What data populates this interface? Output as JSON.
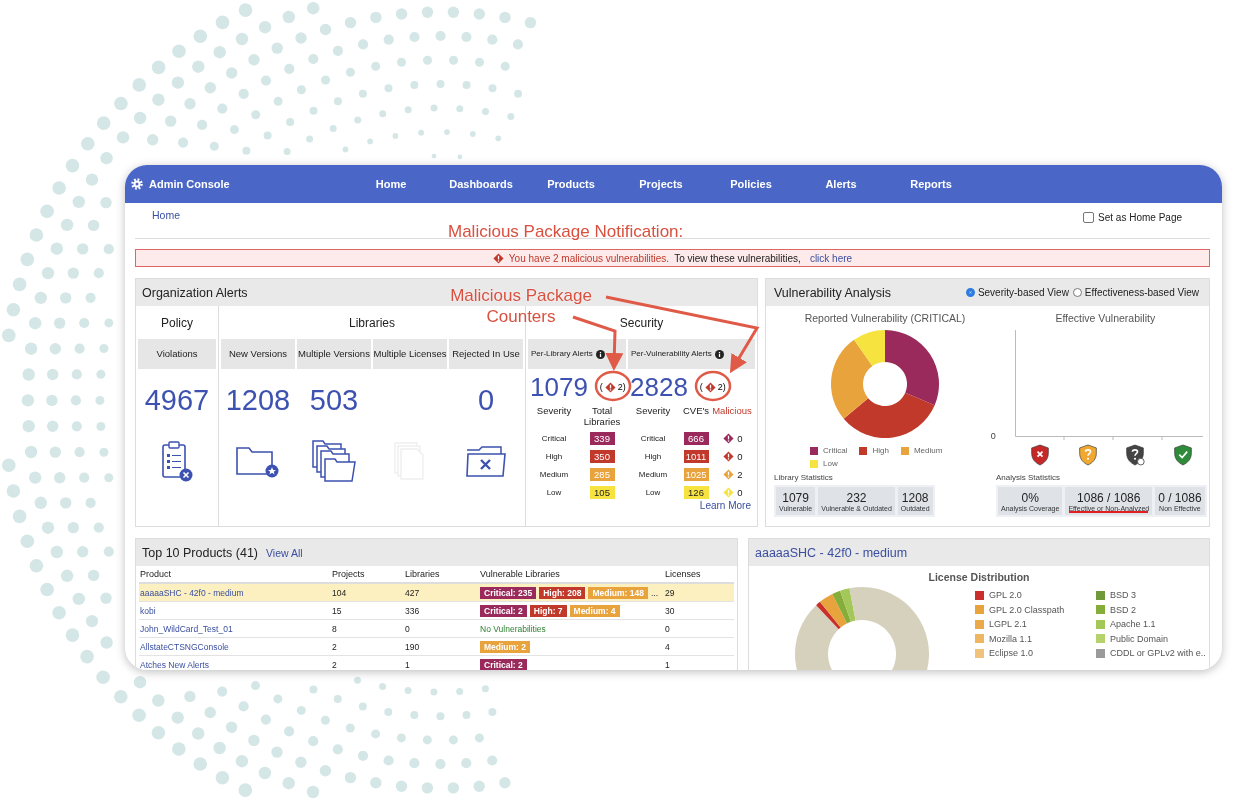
{
  "nav": {
    "title": "Admin Console",
    "items": [
      "Home",
      "Dashboards",
      "Products",
      "Projects",
      "Policies",
      "Alerts",
      "Reports"
    ]
  },
  "breadcrumb": "Home",
  "home_page_checkbox": {
    "label": "Set as Home Page",
    "checked": false
  },
  "annotations": [
    {
      "text": "Malicious Package Notification:"
    },
    {
      "text": "Malicious Package Counters"
    }
  ],
  "alert_banner": {
    "message": "You have 2 malicious vulnerabilities.",
    "hint": "To view these vulnerabilities,",
    "link": "click here"
  },
  "org_alerts": {
    "title": "Organization Alerts",
    "policy": {
      "label": "Policy",
      "columns": [
        {
          "header": "Violations",
          "value": "4967",
          "kind": "violations"
        }
      ]
    },
    "libraries": {
      "label": "Libraries",
      "columns": [
        {
          "header": "New Versions",
          "value": "1208",
          "kind": "new",
          "disabled": false
        },
        {
          "header": "Multiple Versions",
          "value": "503",
          "kind": "versions",
          "disabled": false
        },
        {
          "header": "Multiple Licenses",
          "kind": "licenses",
          "disabled": true
        },
        {
          "header": "Rejected In Use",
          "value": "0",
          "kind": "rejected",
          "disabled": false
        }
      ]
    },
    "security": {
      "label": "Security",
      "per_library": {
        "header": "Per-Library Alerts",
        "value": "1079",
        "malicious_open": "(",
        "malicious_count": "2)",
        "severity_header": "Severity",
        "count_header": "Total Libraries",
        "rows": [
          {
            "label": "Critical",
            "count": "339",
            "color": "#9b2a5c"
          },
          {
            "label": "High",
            "count": "350",
            "color": "#c0392b"
          },
          {
            "label": "Medium",
            "count": "285",
            "color": "#e8a33d"
          },
          {
            "label": "Low",
            "count": "105",
            "color": "#f6e33f"
          }
        ]
      },
      "per_vulnerability": {
        "header": "Per-Vulnerability Alerts",
        "value": "2828",
        "malicious_open": "(",
        "malicious_count": "2)",
        "severity_header": "Severity",
        "count_header": "CVE's",
        "malicious_header": "Malicious",
        "rows": [
          {
            "label": "Critical",
            "count": "666",
            "malicious": "0",
            "color": "#9b2a5c"
          },
          {
            "label": "High",
            "count": "1011",
            "malicious": "0",
            "color": "#c0392b"
          },
          {
            "label": "Medium",
            "count": "1025",
            "malicious": "2",
            "color": "#e8a33d"
          },
          {
            "label": "Low",
            "count": "126",
            "malicious": "0",
            "color": "#f6e33f"
          }
        ]
      },
      "learn_more": "Learn More"
    }
  },
  "vulnerability_analysis": {
    "title": "Vulnerability Analysis",
    "views": [
      {
        "label": "Severity-based View",
        "selected": true
      },
      {
        "label": "Effectiveness-based View",
        "selected": false
      }
    ],
    "reported": {
      "title": "Reported Vulnerability (CRITICAL)",
      "legend": [
        {
          "label": "Critical",
          "color": "#9b2a5c"
        },
        {
          "label": "High",
          "color": "#c0392b"
        },
        {
          "label": "Medium",
          "color": "#e8a33d"
        },
        {
          "label": "Low",
          "color": "#f6e33f"
        }
      ]
    },
    "effective": {
      "title": "Effective Vulnerability",
      "y_tick": "0"
    },
    "library_statistics": {
      "title": "Library Statistics",
      "items": [
        {
          "value": "1079",
          "label": "Vulnerable"
        },
        {
          "value": "232",
          "label": "Vulnerable & Outdated"
        },
        {
          "value": "1208",
          "label": "Outdated"
        }
      ]
    },
    "analysis_statistics": {
      "title": "Analysis Statistics",
      "items": [
        {
          "value": "0%",
          "label": "Analysis Coverage",
          "highlighted": false
        },
        {
          "value": "1086 / 1086",
          "label": "Effective or Non-Analyzed",
          "highlighted": true
        },
        {
          "value": "0 / 1086",
          "label": "Non Effective",
          "highlighted": false
        }
      ]
    }
  },
  "top_products": {
    "title": "Top 10 Products (41)",
    "view_all": "View All",
    "columns": [
      "Product",
      "Projects",
      "Libraries",
      "Vulnerable Libraries",
      "Licenses"
    ],
    "rows": [
      {
        "product": "aaaaaSHC - 42f0 - medium",
        "projects": "104",
        "libraries": "427",
        "vulnerable": [
          {
            "label": "Critical: 235",
            "color": "#9b2a5c"
          },
          {
            "label": "High: 208",
            "color": "#c0392b"
          },
          {
            "label": "Medium: 148",
            "color": "#e8a33d"
          }
        ],
        "more": "...",
        "licenses": "29",
        "selected": true
      },
      {
        "product": "kobi",
        "projects": "15",
        "libraries": "336",
        "vulnerable": [
          {
            "label": "Critical: 2",
            "color": "#9b2a5c"
          },
          {
            "label": "High: 7",
            "color": "#c0392b"
          },
          {
            "label": "Medium: 4",
            "color": "#e8a33d"
          }
        ],
        "licenses": "30",
        "selected": false
      },
      {
        "product": "John_WildCard_Test_01",
        "projects": "8",
        "libraries": "0",
        "status": "No Vulnerabilities",
        "licenses": "0",
        "selected": false
      },
      {
        "product": "AllstateCTSNGConsole",
        "projects": "2",
        "libraries": "190",
        "vulnerable": [
          {
            "label": "Medium: 2",
            "color": "#e8a33d"
          }
        ],
        "licenses": "4",
        "selected": false
      },
      {
        "product": "Atches New Alerts",
        "projects": "2",
        "libraries": "1",
        "vulnerable": [
          {
            "label": "Critical: 2",
            "color": "#9b2a5c"
          }
        ],
        "licenses": "1",
        "selected": false
      }
    ]
  },
  "license_panel": {
    "title": "aaaaaSHC - 42f0 - medium",
    "chart_title": "License Distribution",
    "legend": [
      {
        "label": "GPL 2.0",
        "color": "#c9302c"
      },
      {
        "label": "GPL 2.0 Classpath",
        "color": "#e8a33d"
      },
      {
        "label": "LGPL 2.1",
        "color": "#eba94c"
      },
      {
        "label": "Mozilla 1.1",
        "color": "#efb662"
      },
      {
        "label": "Eclipse 1.0",
        "color": "#f0c27c"
      },
      {
        "label": "BSD 3",
        "color": "#6e9a3a"
      },
      {
        "label": "BSD 2",
        "color": "#86ad3a"
      },
      {
        "label": "Apache 1.1",
        "color": "#a4c75a"
      },
      {
        "label": "Public Domain",
        "color": "#b5d36a"
      },
      {
        "label": "CDDL or GPLv2 with e..",
        "color": "#9a9a9a"
      }
    ]
  }
}
